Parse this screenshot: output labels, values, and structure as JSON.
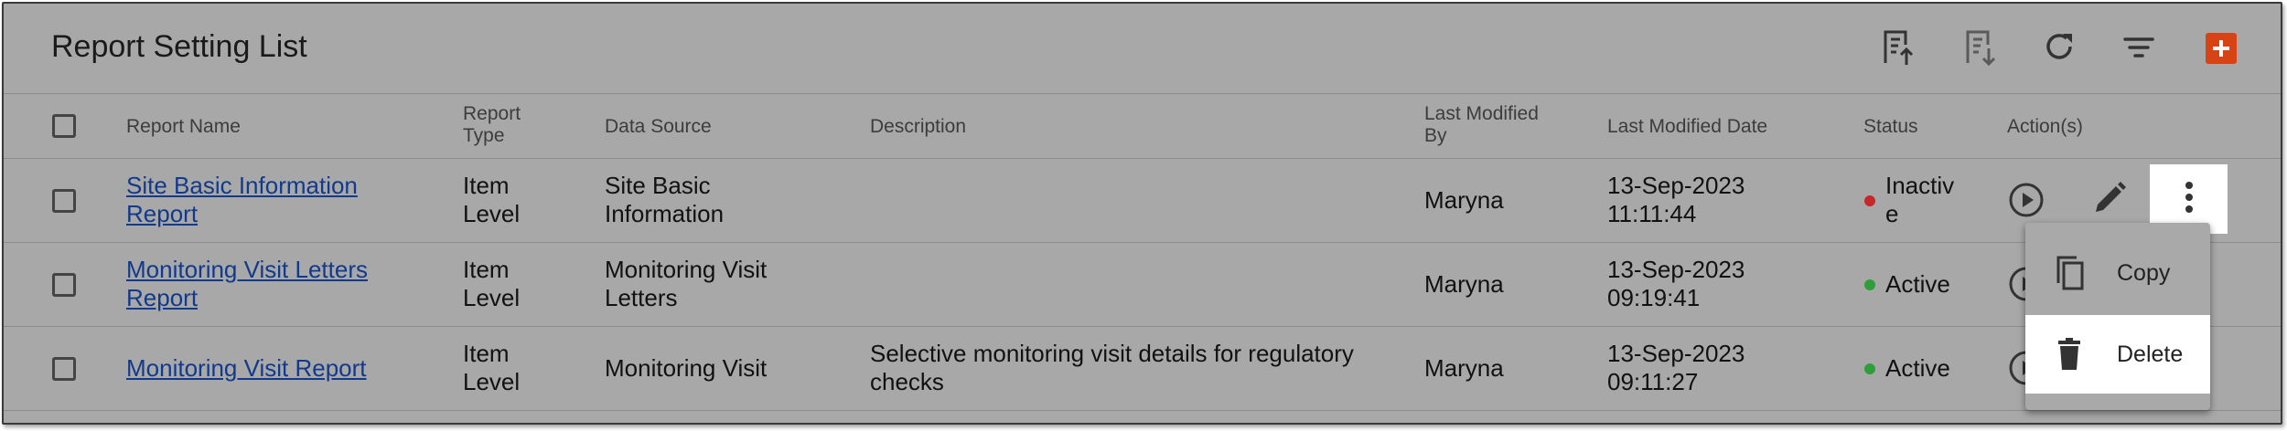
{
  "header": {
    "title": "Report Setting List",
    "toolbar_icons": [
      "upload-report-icon",
      "download-report-icon",
      "refresh-icon",
      "filter-icon",
      "add-icon"
    ],
    "add_color": "#d84315"
  },
  "columns": [
    "Report Name",
    "Report Type",
    "Data Source",
    "Description",
    "Last Modified By",
    "Last Modified Date",
    "Status",
    "Action(s)"
  ],
  "rows": [
    {
      "name": "Site Basic Information Report",
      "type": "Item Level",
      "source": "Site Basic Information",
      "description": "",
      "modified_by": "Maryna",
      "modified_date": "13-Sep-2023 11:11:44",
      "status": "Inactive",
      "status_color": "#c62828"
    },
    {
      "name": "Monitoring Visit Letters Report",
      "type": "Item Level",
      "source": "Monitoring Visit Letters",
      "description": "",
      "modified_by": "Maryna",
      "modified_date": "13-Sep-2023 09:19:41",
      "status": "Active",
      "status_color": "#2e9e3a"
    },
    {
      "name": "Monitoring Visit Report",
      "type": "Item Level",
      "source": "Monitoring Visit",
      "description": "Selective monitoring visit details for regulatory checks",
      "modified_by": "Maryna",
      "modified_date": "13-Sep-2023 09:11:27",
      "status": "Active",
      "status_color": "#2e9e3a"
    }
  ],
  "context_menu": {
    "items": [
      {
        "label": "Copy",
        "icon": "copy-icon"
      },
      {
        "label": "Delete",
        "icon": "delete-icon",
        "highlighted": true
      }
    ]
  }
}
